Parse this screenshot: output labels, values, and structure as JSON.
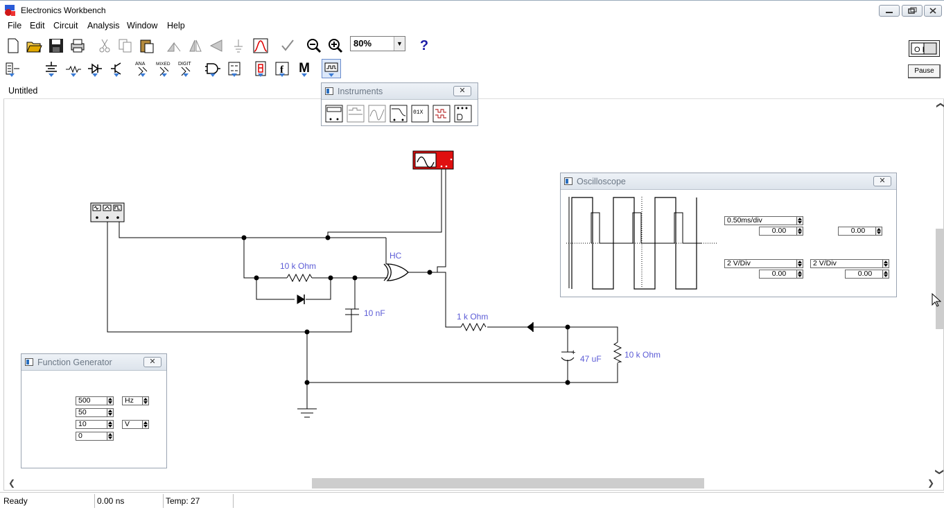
{
  "window": {
    "title": "Electronics Workbench"
  },
  "menu": [
    "File",
    "Edit",
    "Circuit",
    "Analysis",
    "Window",
    "Help"
  ],
  "toolbar": {
    "zoom_value": "80%",
    "help_label": "?",
    "parts_labels": {
      "analog": "ANA",
      "mixed": "MIXED",
      "digital": "DIGIT",
      "misc": "M"
    }
  },
  "power": {
    "pause_label": "Pause",
    "switch_label": "O I"
  },
  "document": {
    "title": "Untitled"
  },
  "instruments_panel": {
    "title": "Instruments"
  },
  "oscilloscope": {
    "title": "Oscilloscope",
    "timebase": "0.50ms/div",
    "x_position": "0.00",
    "trigger_level": "0.00",
    "channel_a": {
      "scale": "2  V/Div",
      "position": "0.00"
    },
    "channel_b": {
      "scale": "2  V/Div",
      "position": "0.00"
    }
  },
  "function_generator": {
    "title": "Function Generator",
    "frequency": "500",
    "frequency_unit": "Hz",
    "duty_cycle": "50",
    "amplitude": "10",
    "amplitude_unit": "V",
    "offset": "0"
  },
  "circuit": {
    "labels": {
      "gate": "HC",
      "r1": "10 k Ohm",
      "c1": "10 nF",
      "r2": "1 k Ohm",
      "c2": "47 uF",
      "r3": "10 k Ohm",
      "c2_polarity": "+"
    }
  },
  "status": {
    "state": "Ready",
    "time": "0.00 ns",
    "temp": "Temp:  27"
  }
}
